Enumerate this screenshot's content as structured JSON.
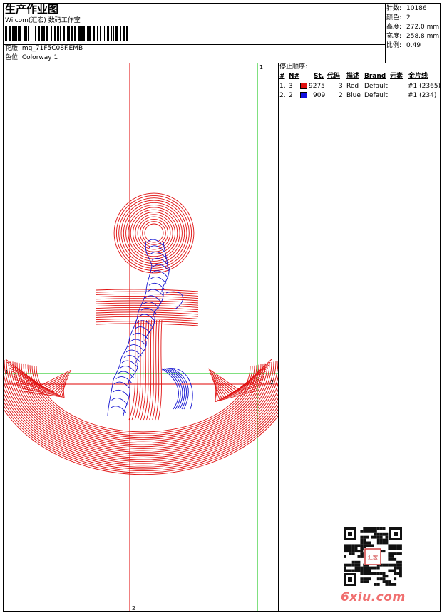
{
  "header": {
    "title": "生产作业图",
    "subtitle": "Wilcom(汇宏) 数码工作室",
    "design_label": "花版: mg_71F5C08F.EMB",
    "colorway_label": "色位: Colorway 1"
  },
  "stats": [
    {
      "label": "针数:",
      "value": "10186"
    },
    {
      "label": "颜色:",
      "value": "2"
    },
    {
      "label": "高度:",
      "value": "272.0 mm"
    },
    {
      "label": "宽度:",
      "value": "258.8 mm"
    },
    {
      "label": "比例:",
      "value": "0.49"
    }
  ],
  "stop_sequence": {
    "title": "停止顺序:",
    "headers": {
      "num": "#",
      "n": "N#",
      "st": "St.",
      "code": "代码",
      "desc": "描述",
      "brand": "Brand",
      "element": "元素",
      "thread": "金片线"
    },
    "rows": [
      {
        "num": "1.",
        "n": "3",
        "swatch_color": "#e01010",
        "st": "9275",
        "code": "3",
        "desc": "Red",
        "brand": "Default",
        "thread": "#1 (2365)"
      },
      {
        "num": "2.",
        "n": "2",
        "swatch_color": "#1010e0",
        "st": "909",
        "code": "2",
        "desc": "Blue",
        "brand": "Default",
        "thread": "#1 (234)"
      }
    ]
  },
  "guides": {
    "label_vertical_top": "1",
    "label_vertical_bottom": "2",
    "label_horizontal_left": "1",
    "label_horizontal_right": "2"
  },
  "colors": {
    "red_thread": "#e01010",
    "blue_thread": "#1010d0",
    "guide_red": "#e00000",
    "guide_green": "#00c000",
    "watermark": "#f07070"
  },
  "watermark": "6xiu.com",
  "stamp_text": "汇宏"
}
